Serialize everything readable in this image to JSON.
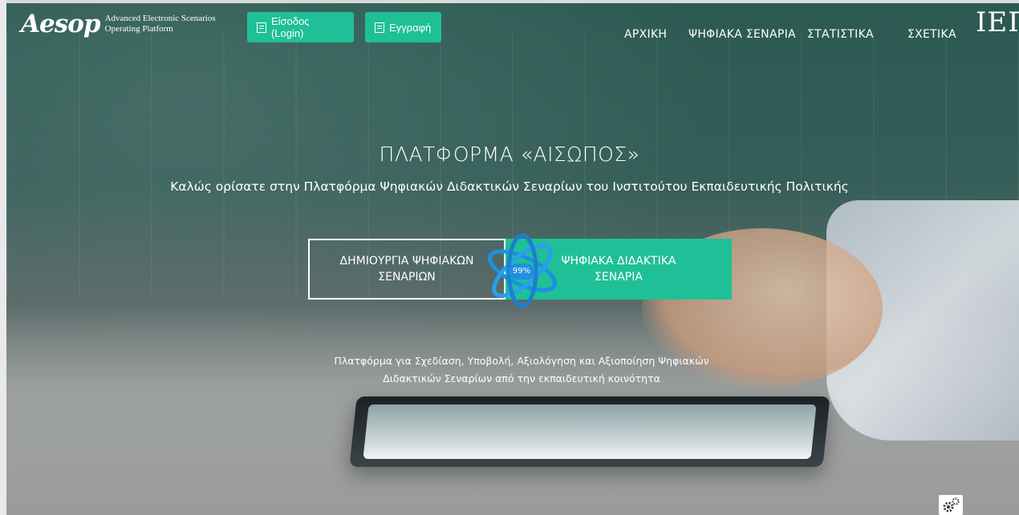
{
  "logo": {
    "word": "Aesop",
    "sub_line1": "Advanced Electronic Scenarios",
    "sub_line2": "Operating Platform"
  },
  "header": {
    "login_label": "Είσοδος (Login)",
    "register_label": "Εγγραφή",
    "nav": [
      "ΑΡΧΙΚΗ",
      "ΨΗΦΙΑΚΑ ΣΕΝΑΡΙΑ",
      "ΣΤΑΤΙΣΤΙΚΑ",
      "ΣΧΕΤΙΚΑ"
    ],
    "iep_logo": "ΙΕΠ"
  },
  "hero": {
    "title": "ΠΛΑΤΦΟΡΜΑ «ΑΙΣΩΠΟΣ»",
    "subtitle": "Καλώς ορίσατε στην Πλατφόρμα Ψηφιακών Διδακτικών Σεναρίων του Ινστιτούτου Εκπαιδευτικής Πολιτικής",
    "create_button": "ΔΗΜΙΟΥΡΓΙΑ ΨΗΦΙΑΚΩΝ ΣΕΝΑΡΙΩΝ",
    "browse_button": "ΨΗΦΙΑΚΑ ΔΙΔΑΚΤΙΚΑ ΣΕΝΑΡΙΑ",
    "loader_percent": "99%",
    "description_line1": "Πλατφόρμα για Σχεδίαση, Υποβολή, Αξιολόγηση και Αξιοποίηση Ψηφιακών",
    "description_line2": "Διδακτικών Σεναρίων από την εκπαιδευτική κοινότητα"
  },
  "icons": {
    "login": "document-icon",
    "register": "document-icon",
    "settings": "gears-icon",
    "loader": "atom-spinner-icon"
  },
  "colors": {
    "accent": "#1fbf98",
    "loader_blue": "#1f8fe0"
  }
}
